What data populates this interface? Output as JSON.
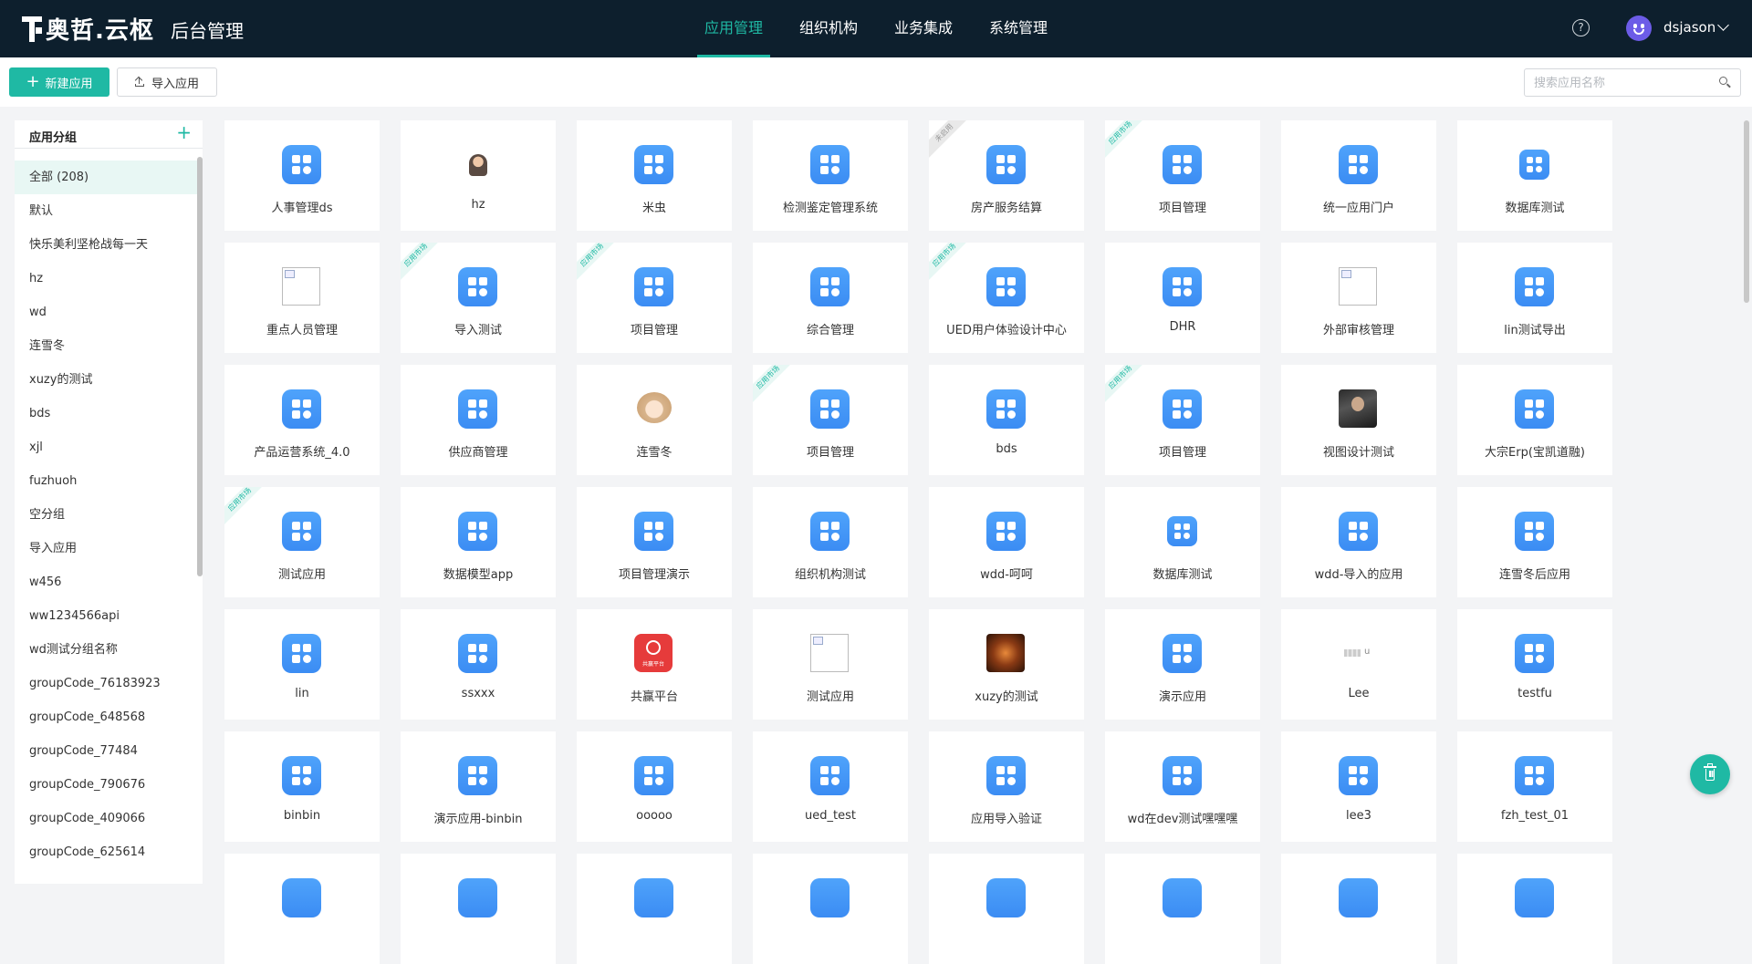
{
  "header": {
    "logo_text": "奥哲.云枢",
    "system_title": "后台管理",
    "nav": [
      {
        "label": "应用管理",
        "active": true
      },
      {
        "label": "组织机构",
        "active": false
      },
      {
        "label": "业务集成",
        "active": false
      },
      {
        "label": "系统管理",
        "active": false
      }
    ],
    "help_glyph": "?",
    "username": "dsjason"
  },
  "toolbar": {
    "new_app_label": "新建应用",
    "import_app_label": "导入应用",
    "search_placeholder": "搜索应用名称"
  },
  "sidebar": {
    "title": "应用分组",
    "add_glyph": "+",
    "groups": [
      "全部 (208)",
      "默认",
      "快乐美利坚枪战每一天",
      "hz",
      "wd",
      "连雪冬",
      "xuzy的测试",
      "bds",
      "xjl",
      "fuzhuoh",
      "空分组",
      "导入应用",
      "w456",
      "ww1234566api",
      "wd测试分组名称",
      "groupCode_76183923",
      "groupCode_648568",
      "groupCode_77484",
      "groupCode_790676",
      "groupCode_409066",
      "groupCode_625614"
    ]
  },
  "ribbons": {
    "market": "应用市场",
    "disabled": "未启用"
  },
  "apps": [
    {
      "name": "人事管理ds",
      "icon": "app-grid-icon",
      "ribbon": ""
    },
    {
      "name": "hz",
      "icon": "person-avatar-icon",
      "ribbon": ""
    },
    {
      "name": "米虫",
      "icon": "app-grid-icon",
      "ribbon": ""
    },
    {
      "name": "检测鉴定管理系统",
      "icon": "app-grid-icon",
      "ribbon": ""
    },
    {
      "name": "房产服务结算",
      "icon": "app-grid-icon",
      "ribbon": "disabled"
    },
    {
      "name": "项目管理",
      "icon": "app-grid-icon",
      "ribbon": "market"
    },
    {
      "name": "统一应用门户",
      "icon": "app-grid-icon",
      "ribbon": ""
    },
    {
      "name": "数据库测试",
      "icon": "app-grid-small-icon",
      "ribbon": ""
    },
    {
      "name": "重点人员管理",
      "icon": "broken-image-icon",
      "ribbon": ""
    },
    {
      "name": "导入测试",
      "icon": "app-grid-icon",
      "ribbon": "market"
    },
    {
      "name": "项目管理",
      "icon": "app-grid-icon",
      "ribbon": "market"
    },
    {
      "name": "综合管理",
      "icon": "app-grid-icon",
      "ribbon": ""
    },
    {
      "name": "UED用户体验设计中心",
      "icon": "app-grid-icon",
      "ribbon": "market"
    },
    {
      "name": "DHR",
      "icon": "app-grid-icon",
      "ribbon": ""
    },
    {
      "name": "外部审核管理",
      "icon": "broken-image-icon",
      "ribbon": ""
    },
    {
      "name": "lin测试导出",
      "icon": "app-grid-icon",
      "ribbon": ""
    },
    {
      "name": "产品运营系统_4.0",
      "icon": "app-grid-icon",
      "ribbon": ""
    },
    {
      "name": "供应商管理",
      "icon": "app-grid-icon",
      "ribbon": ""
    },
    {
      "name": "连雪冬",
      "icon": "doll-avatar-icon",
      "ribbon": ""
    },
    {
      "name": "项目管理",
      "icon": "app-grid-icon",
      "ribbon": "market"
    },
    {
      "name": "bds",
      "icon": "app-grid-icon",
      "ribbon": ""
    },
    {
      "name": "项目管理",
      "icon": "app-grid-icon",
      "ribbon": "market"
    },
    {
      "name": "视图设计测试",
      "icon": "suit-photo-icon",
      "ribbon": ""
    },
    {
      "name": "大宗Erp(宝凯道融)",
      "icon": "app-grid-icon",
      "ribbon": ""
    },
    {
      "name": "测试应用",
      "icon": "app-grid-icon",
      "ribbon": "market"
    },
    {
      "name": "数据模型app",
      "icon": "app-grid-icon",
      "ribbon": ""
    },
    {
      "name": "项目管理演示",
      "icon": "app-grid-icon",
      "ribbon": ""
    },
    {
      "name": "组织机构测试",
      "icon": "app-grid-icon",
      "ribbon": ""
    },
    {
      "name": "wdd-呵呵",
      "icon": "app-grid-icon",
      "ribbon": ""
    },
    {
      "name": "数据库测试",
      "icon": "app-grid-small-icon",
      "ribbon": ""
    },
    {
      "name": "wdd-导入的应用",
      "icon": "app-grid-icon",
      "ribbon": ""
    },
    {
      "name": "连雪冬后应用",
      "icon": "app-grid-icon",
      "ribbon": ""
    },
    {
      "name": "lin",
      "icon": "app-grid-icon",
      "ribbon": ""
    },
    {
      "name": "ssxxx",
      "icon": "app-grid-icon",
      "ribbon": ""
    },
    {
      "name": "共赢平台",
      "icon": "red-app-icon",
      "ribbon": ""
    },
    {
      "name": "测试应用",
      "icon": "broken-image-icon",
      "ribbon": ""
    },
    {
      "name": "xuzy的测试",
      "icon": "fire-photo-icon",
      "ribbon": ""
    },
    {
      "name": "演示应用",
      "icon": "app-grid-icon",
      "ribbon": ""
    },
    {
      "name": "Lee",
      "icon": "blurred-image-icon",
      "ribbon": ""
    },
    {
      "name": "testfu",
      "icon": "app-grid-icon",
      "ribbon": ""
    },
    {
      "name": "binbin",
      "icon": "app-grid-icon",
      "ribbon": ""
    },
    {
      "name": "演示应用-binbin",
      "icon": "app-grid-icon",
      "ribbon": ""
    },
    {
      "name": "ooooo",
      "icon": "app-grid-icon",
      "ribbon": ""
    },
    {
      "name": "ued_test",
      "icon": "app-grid-icon",
      "ribbon": ""
    },
    {
      "name": "应用导入验证",
      "icon": "app-grid-icon",
      "ribbon": ""
    },
    {
      "name": "wd在dev测试嘿嘿嘿",
      "icon": "app-grid-icon",
      "ribbon": ""
    },
    {
      "name": "lee3",
      "icon": "app-grid-icon",
      "ribbon": ""
    },
    {
      "name": "fzh_test_01",
      "icon": "app-grid-icon",
      "ribbon": ""
    }
  ],
  "red_app_text": "共赢平台",
  "blurred_suffix": "u",
  "colors": {
    "accent": "#1fb9a4",
    "header_bg": "#0d1f2d",
    "app_icon": "#4597f8"
  }
}
